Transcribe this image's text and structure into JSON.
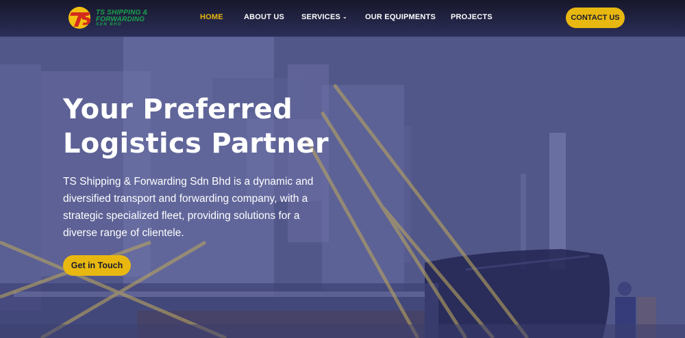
{
  "brand": {
    "logo_initials": "TS",
    "name_line1": "TS SHIPPING &",
    "name_line2": "FORWARDING",
    "name_line3": "SDN BHD",
    "colors": {
      "primary_text": "#19a24d",
      "mark_red": "#d42a1e",
      "mark_yellow": "#f2c011"
    }
  },
  "nav": {
    "items": [
      {
        "label": "HOME",
        "active": true
      },
      {
        "label": "ABOUT US",
        "active": false
      },
      {
        "label": "SERVICES",
        "active": false,
        "has_dropdown": true,
        "dropdown_icon": "chevron-down-icon"
      },
      {
        "label": "OUR EQUIPMENTS",
        "active": false
      },
      {
        "label": "PROJECTS",
        "active": false
      }
    ],
    "contact_label": "CONTACT US"
  },
  "hero": {
    "title_line1": "Your Preferred",
    "title_line2": "Logistics Partner",
    "description": "TS Shipping & Forwarding Sdn Bhd is a dynamic and diversified transport and forwarding company, with a strategic specialized fleet, providing solutions for a diverse range of clientele.",
    "cta_label": "Get in Touch",
    "background_image": "cargo-ship-loading-photo"
  },
  "colors": {
    "accent": "#e8b810",
    "header_bg": "#1f2040",
    "hero_overlay": "#4e5388",
    "text_light": "#ffffff"
  }
}
